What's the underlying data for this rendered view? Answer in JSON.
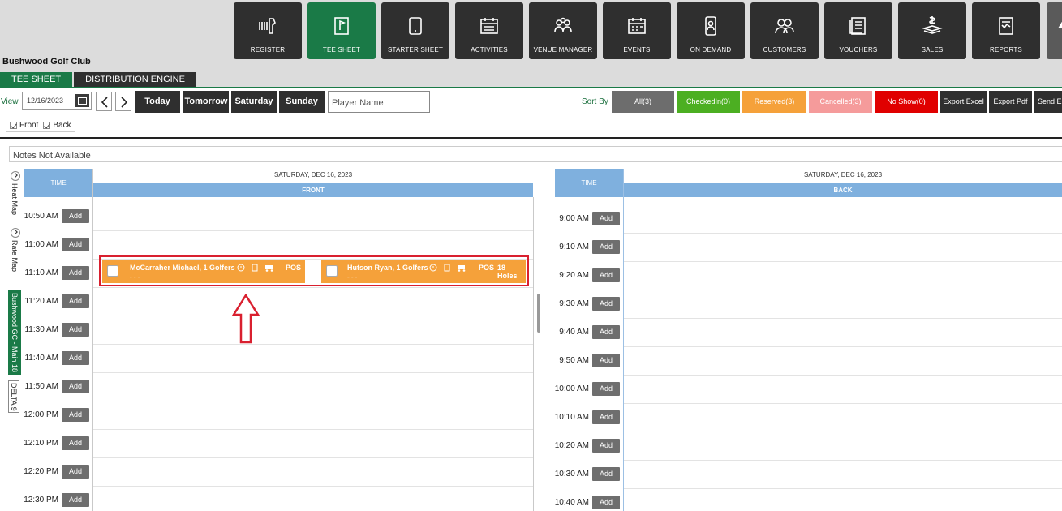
{
  "nav": {
    "tiles": [
      {
        "label": "REGISTER",
        "icon": "barcode-scanner-icon"
      },
      {
        "label": "TEE SHEET",
        "icon": "flag-icon"
      },
      {
        "label": "STARTER SHEET",
        "icon": "tablet-icon"
      },
      {
        "label": "ACTIVITIES",
        "icon": "calendar-list-icon"
      },
      {
        "label": "VENUE MANAGER",
        "icon": "group-icon"
      },
      {
        "label": "EVENTS",
        "icon": "event-calendar-icon"
      },
      {
        "label": "ON DEMAND",
        "icon": "mobile-person-icon"
      },
      {
        "label": "CUSTOMERS",
        "icon": "users-icon"
      },
      {
        "label": "VOUCHERS",
        "icon": "ticket-icon"
      },
      {
        "label": "SALES",
        "icon": "money-icon"
      },
      {
        "label": "REPORTS",
        "icon": "report-icon"
      }
    ],
    "active": "TEE SHEET",
    "accent": "#1a7a47"
  },
  "club_name": "Bushwood Golf Club",
  "subtabs": [
    "TEE SHEET",
    "DISTRIBUTION ENGINE"
  ],
  "toolbar": {
    "view_label": "View",
    "date_value": "12/16/2023",
    "day_buttons": [
      "Today",
      "Tomorrow",
      "Saturday",
      "Sunday"
    ],
    "player_placeholder": "Player Name",
    "sort_label": "Sort By",
    "sort_buttons": [
      {
        "label": "All(3)",
        "color": "#6d6d6d"
      },
      {
        "label": "CheckedIn(0)",
        "color": "#4caf22"
      },
      {
        "label": "Reserved(3)",
        "color": "#f5a13a"
      },
      {
        "label": "Cancelled(3)",
        "color": "#f59b9b"
      },
      {
        "label": "No Show(0)",
        "color": "#e00000"
      }
    ],
    "export_buttons": [
      "Export Excel",
      "Export Pdf",
      "Send E"
    ]
  },
  "filters": {
    "front": "Front",
    "back": "Back"
  },
  "notes": "Notes Not Available",
  "side_labels": {
    "heat_map": "Heat Map",
    "rate_map": "Rate Map",
    "course": "Bushwood GC - Main 18",
    "delta": "DELTA 9"
  },
  "front": {
    "time_header": "TIME",
    "date": "SATURDAY, DEC 16, 2023",
    "side": "FRONT",
    "times": [
      "10:50 AM",
      "11:00 AM",
      "11:10 AM",
      "11:20 AM",
      "11:30 AM",
      "11:40 AM",
      "11:50 AM",
      "12:00 PM",
      "12:10 PM",
      "12:20 PM",
      "12:30 PM"
    ]
  },
  "back": {
    "time_header": "TIME",
    "date": "SATURDAY, DEC 16, 2023",
    "side": "BACK",
    "times": [
      "9:00 AM",
      "9:10 AM",
      "9:20 AM",
      "9:30 AM",
      "9:40 AM",
      "9:50 AM",
      "10:00 AM",
      "10:10 AM",
      "10:20 AM",
      "10:30 AM",
      "10:40 AM"
    ]
  },
  "add_label": "Add",
  "bookings": [
    {
      "name": "McCarraher Michael, 1 Golfers",
      "pos": "POS",
      "holes": "",
      "sub": "- - -"
    },
    {
      "name": "Hutson Ryan, 1 Golfers",
      "pos": "POS",
      "holes": "18 Holes",
      "sub": "- - -"
    }
  ]
}
